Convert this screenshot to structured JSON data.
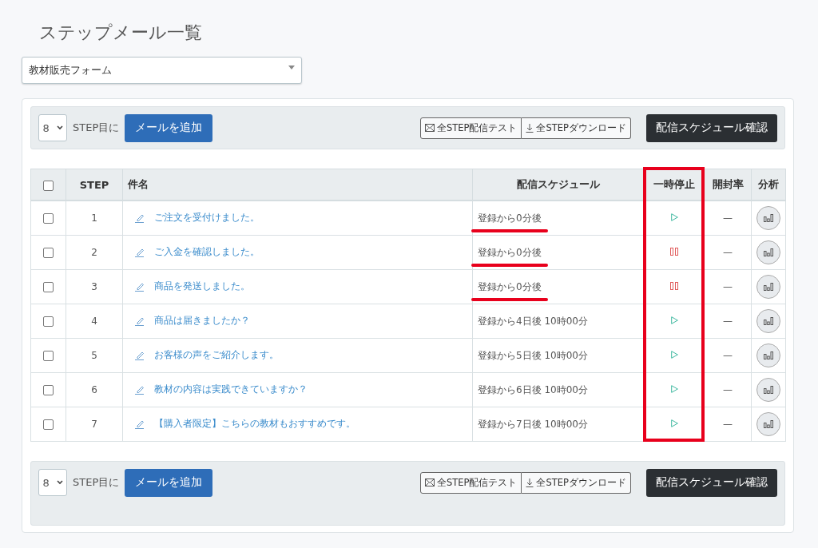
{
  "page_title": "ステップメール一覧",
  "form_select": {
    "value": "教材販売フォーム"
  },
  "toolbars": [
    {
      "step_select": "8",
      "step_label": "STEP目に",
      "add_button": "メールを追加",
      "test_button": "全STEP配信テスト",
      "download_button": "全STEPダウンロード",
      "schedule_button": "配信スケジュール確認"
    },
    {
      "step_select": "8",
      "step_label": "STEP目に",
      "add_button": "メールを追加",
      "test_button": "全STEP配信テスト",
      "download_button": "全STEPダウンロード",
      "schedule_button": "配信スケジュール確認"
    }
  ],
  "table": {
    "columns": [
      {
        "kind": "check"
      },
      {
        "label": "STEP",
        "kind": "step"
      },
      {
        "label": "件名",
        "kind": "subject"
      },
      {
        "label": "配信スケジュール",
        "kind": "schedule"
      },
      {
        "label": "一時停止",
        "kind": "pause",
        "highlighted": true
      },
      {
        "label": "開封率",
        "kind": "rate"
      },
      {
        "label": "分析",
        "kind": "analysis"
      }
    ],
    "header_checked": false,
    "rows": [
      {
        "checked": false,
        "step": "1",
        "subject": "ご注文を受付けました。",
        "schedule": "登録から0分後",
        "schedule_underlined": true,
        "paused": false,
        "open_rate": "—"
      },
      {
        "checked": false,
        "step": "2",
        "subject": "ご入金を確認しました。",
        "schedule": "登録から0分後",
        "schedule_underlined": true,
        "paused": true,
        "open_rate": "—"
      },
      {
        "checked": false,
        "step": "3",
        "subject": "商品を発送しました。",
        "schedule": "登録から0分後",
        "schedule_underlined": true,
        "paused": true,
        "open_rate": "—"
      },
      {
        "checked": false,
        "step": "4",
        "subject": "商品は届きましたか？",
        "schedule": "登録から4日後 10時00分",
        "schedule_underlined": false,
        "paused": false,
        "open_rate": "—"
      },
      {
        "checked": false,
        "step": "5",
        "subject": "お客様の声をご紹介します。",
        "schedule": "登録から5日後 10時00分",
        "schedule_underlined": false,
        "paused": false,
        "open_rate": "—"
      },
      {
        "checked": false,
        "step": "6",
        "subject": "教材の内容は実践できていますか？",
        "schedule": "登録から6日後 10時00分",
        "schedule_underlined": false,
        "paused": false,
        "open_rate": "—"
      },
      {
        "checked": false,
        "step": "7",
        "subject": "【購入者限定】こちらの教材もおすすめです。",
        "schedule": "登録から7日後 10時00分",
        "schedule_underlined": false,
        "paused": false,
        "open_rate": "—"
      }
    ]
  }
}
